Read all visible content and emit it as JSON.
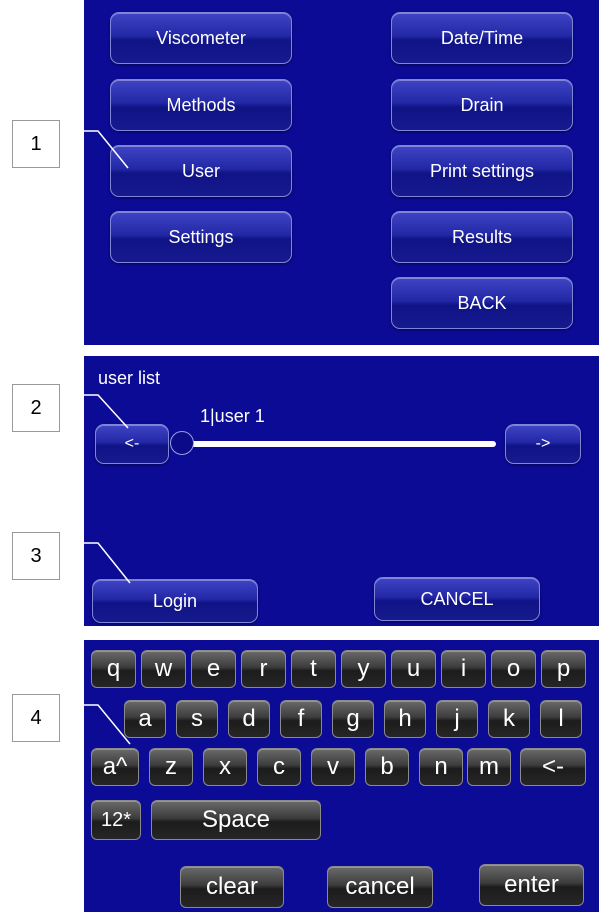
{
  "menu": {
    "left": [
      "Viscometer",
      "Methods",
      "User",
      "Settings"
    ],
    "right": [
      "Date/Time",
      "Drain",
      "Print settings",
      "Results",
      "BACK"
    ]
  },
  "user_dialog": {
    "title": "user list",
    "current_user": "1|user 1",
    "prev_label": "<-",
    "next_label": "->",
    "login_label": "Login",
    "cancel_label": "CANCEL"
  },
  "keyboard": {
    "row1": [
      "q",
      "w",
      "e",
      "r",
      "t",
      "y",
      "u",
      "i",
      "o",
      "p"
    ],
    "row2": [
      "a",
      "s",
      "d",
      "f",
      "g",
      "h",
      "j",
      "k",
      "l"
    ],
    "shift_label": "a^",
    "row3": [
      "z",
      "x",
      "c",
      "v",
      "b",
      "n",
      "m"
    ],
    "backspace_label": "<-",
    "numeric_label": "12*",
    "space_label": "Space",
    "clear_label": "clear",
    "cancel_label": "cancel",
    "enter_label": "enter"
  },
  "callouts": [
    "1",
    "2",
    "3",
    "4"
  ],
  "colors": {
    "panel_bg": "#0b0b96",
    "button_face": "#2328a6",
    "key_face": "#3c3c3c"
  }
}
